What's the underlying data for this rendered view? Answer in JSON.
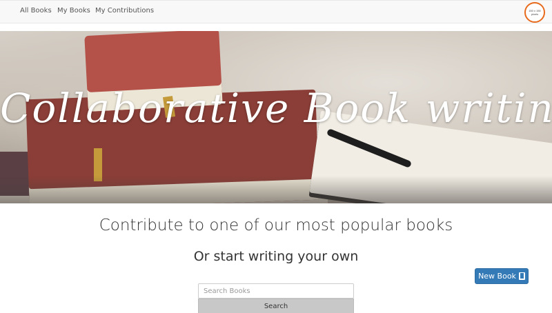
{
  "nav": {
    "items": [
      {
        "label": "All Books"
      },
      {
        "label": "My Books"
      },
      {
        "label": "My Contributions"
      }
    ],
    "avatar_text": "150 x 150 pixels"
  },
  "hero": {
    "title": "Collaborative Book writing"
  },
  "main": {
    "headline": "Contribute to one of our most popular books",
    "subheadline": "Or start writing your own",
    "new_book_label": "New Book",
    "search_placeholder": "Search Books",
    "search_button_label": "Search"
  },
  "colors": {
    "primary": "#337ab7",
    "navbar_bg": "#f8f8f8"
  }
}
